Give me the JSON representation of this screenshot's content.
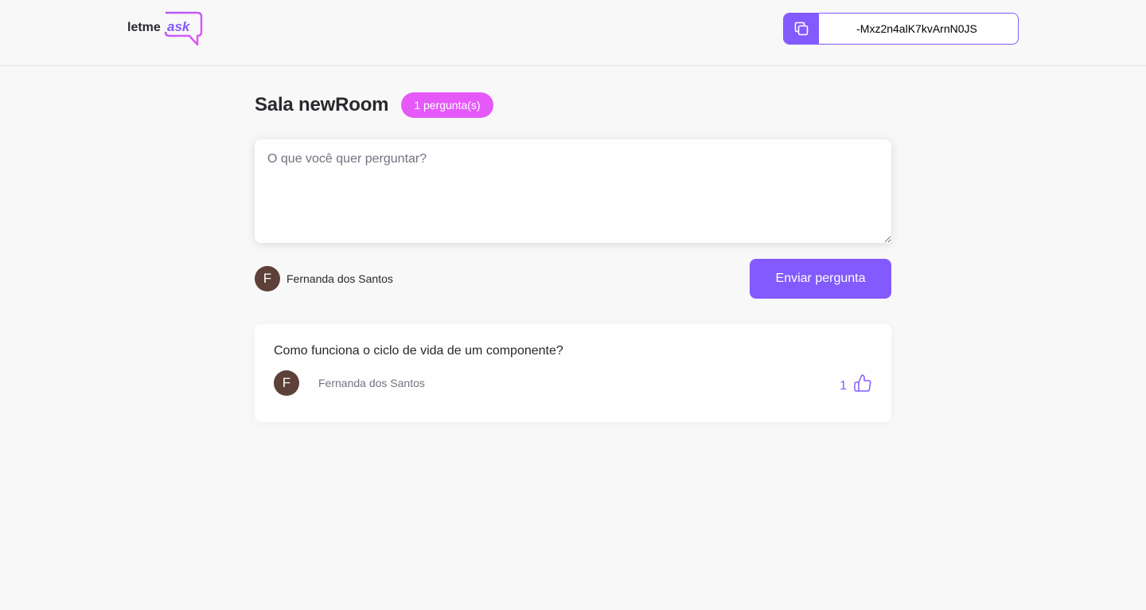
{
  "header": {
    "logo_text": {
      "part1": "letme",
      "part2": "ask"
    },
    "room_code": "-Mxz2n4alK7kvArnN0JS",
    "copy_icon": "copy-icon"
  },
  "room": {
    "title": "Sala newRoom",
    "question_count_label": "1 pergunta(s)"
  },
  "form": {
    "placeholder": "O que você quer perguntar?",
    "user": {
      "avatar_initial": "F",
      "name": "Fernanda dos Santos"
    },
    "submit_label": "Enviar pergunta"
  },
  "questions": [
    {
      "text": "Como funciona o ciclo de vida de um componente?",
      "author": {
        "avatar_initial": "F",
        "name": "Fernanda dos Santos"
      },
      "like_count": "1",
      "like_icon": "thumbs-up-icon"
    }
  ],
  "colors": {
    "brand": "#835afd",
    "badge": "#e559f9",
    "avatar": "#5d4037",
    "background": "#f8f8f8"
  }
}
